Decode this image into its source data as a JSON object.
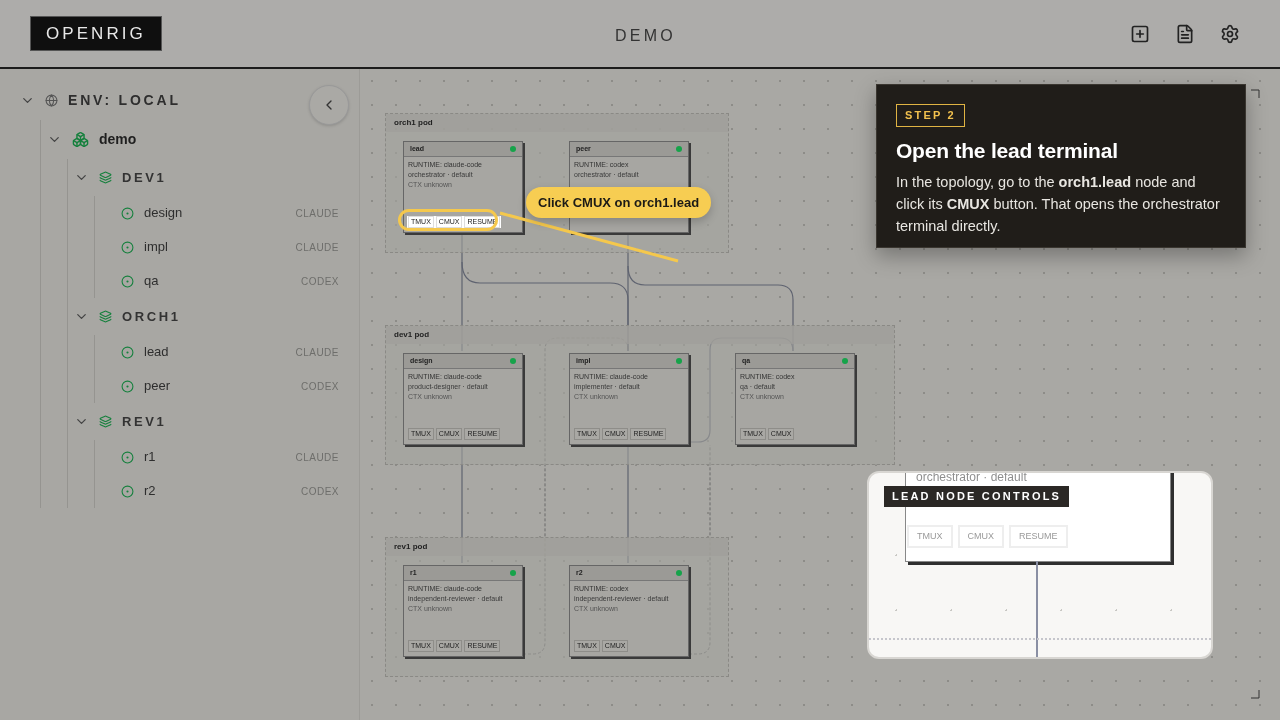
{
  "header": {
    "logo": "OPENRIG",
    "title": "DEMO"
  },
  "sidebar": {
    "tree": [
      {
        "kind": "env",
        "label": "ENV: LOCAL",
        "expanded": true,
        "children": [
          {
            "kind": "rig",
            "label": "demo",
            "expanded": true,
            "children": [
              {
                "kind": "pod",
                "label": "DEV1",
                "expanded": true,
                "children": [
                  {
                    "kind": "agent",
                    "label": "design",
                    "runtime": "CLAUDE"
                  },
                  {
                    "kind": "agent",
                    "label": "impl",
                    "runtime": "CLAUDE"
                  },
                  {
                    "kind": "agent",
                    "label": "qa",
                    "runtime": "CODEX"
                  }
                ]
              },
              {
                "kind": "pod",
                "label": "ORCH1",
                "expanded": true,
                "children": [
                  {
                    "kind": "agent",
                    "label": "lead",
                    "runtime": "CLAUDE"
                  },
                  {
                    "kind": "agent",
                    "label": "peer",
                    "runtime": "CODEX"
                  }
                ]
              },
              {
                "kind": "pod",
                "label": "REV1",
                "expanded": true,
                "children": [
                  {
                    "kind": "agent",
                    "label": "r1",
                    "runtime": "CLAUDE"
                  },
                  {
                    "kind": "agent",
                    "label": "r2",
                    "runtime": "CODEX"
                  }
                ]
              }
            ]
          }
        ]
      }
    ]
  },
  "canvas": {
    "pods": [
      {
        "title": "orch1 pod",
        "nodes": [
          {
            "name": "lead",
            "color": "#16a34a",
            "runtime": "RUNTIME: claude-code",
            "role": "orchestrator · default",
            "context": "CTX unknown",
            "buttons": [
              "TMUX",
              "CMUX",
              "RESUME"
            ],
            "highlighted": true
          },
          {
            "name": "peer",
            "color": "#16a34a",
            "runtime": "RUNTIME: codex",
            "role": "orchestrator · default",
            "highlighted": false
          }
        ]
      },
      {
        "title": "dev1 pod",
        "nodes": [
          {
            "name": "design",
            "color": "#16a34a",
            "runtime": "RUNTIME: claude-code",
            "role": "product-designer · default",
            "context": "CTX unknown",
            "buttons": [
              "TMUX",
              "CMUX",
              "RESUME"
            ],
            "highlighted": false
          },
          {
            "name": "impl",
            "color": "#16a34a",
            "runtime": "RUNTIME: claude-code",
            "role": "implementer · default",
            "context": "CTX unknown",
            "buttons": [
              "TMUX",
              "CMUX",
              "RESUME"
            ],
            "highlighted": false
          },
          {
            "name": "qa",
            "color": "#16a34a",
            "runtime": "RUNTIME: codex",
            "role": "qa · default",
            "context": "CTX unknown",
            "buttons": [
              "TMUX",
              "CMUX"
            ],
            "highlighted": false
          }
        ]
      },
      {
        "title": "rev1 pod",
        "nodes": [
          {
            "name": "r1",
            "color": "#16a34a",
            "runtime": "RUNTIME: claude-code",
            "role": "independent-reviewer · default",
            "context": "CTX unknown",
            "buttons": [
              "TMUX",
              "CMUX",
              "RESUME"
            ],
            "highlighted": false
          },
          {
            "name": "r2",
            "color": "#16a34a",
            "runtime": "RUNTIME: codex",
            "role": "independent-reviewer · default",
            "context": "CTX unknown",
            "buttons": [
              "TMUX",
              "CMUX"
            ],
            "highlighted": false
          }
        ]
      }
    ]
  },
  "callout": {
    "text": "Click CMUX on orch1.lead"
  },
  "tour": {
    "step": "STEP 2",
    "title": "Open the lead terminal",
    "body": "In the topology, go to the **orch1.lead** node and click its **CMUX** button. That opens the orchestrator terminal directly."
  },
  "inset": {
    "label": "LEAD NODE CONTROLS",
    "role": "orchestrator · default",
    "buttons": [
      "TMUX",
      "CMUX",
      "RESUME"
    ]
  }
}
